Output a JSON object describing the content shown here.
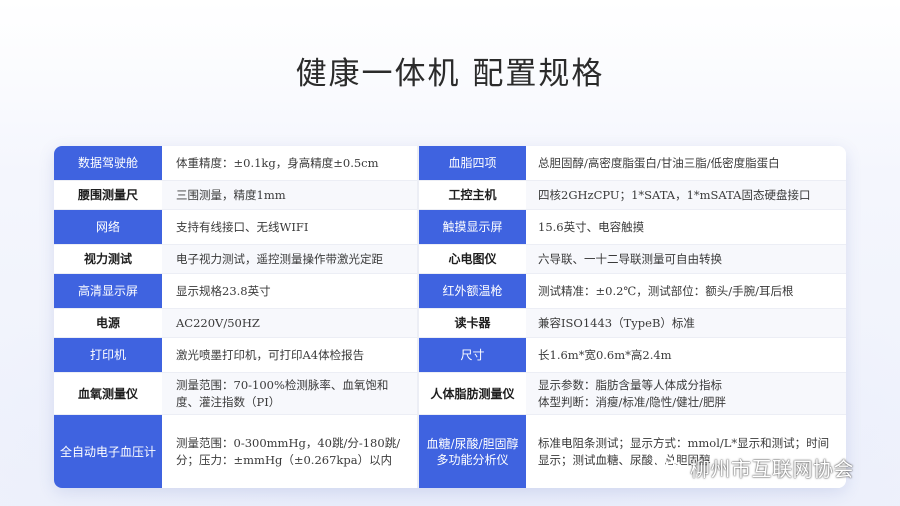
{
  "title": "健康一体机  配置规格",
  "rows": [
    {
      "style": "blue",
      "label1": "数据驾驶舱",
      "value1": "体重精度：±0.1kg，身高精度±0.5cm",
      "label2": "血脂四项",
      "value2": "总胆固醇/高密度脂蛋白/甘油三脂/低密度脂蛋白"
    },
    {
      "style": "white",
      "label1": "腰围测量尺",
      "value1": "三围测量，精度1mm",
      "label2": "工控主机",
      "value2": "四核2GHzCPU；1*SATA，1*mSATA固态硬盘接口"
    },
    {
      "style": "blue",
      "label1": "网络",
      "value1": "支持有线接口、无线WIFI",
      "label2": "触摸显示屏",
      "value2": "15.6英寸、电容触摸"
    },
    {
      "style": "white",
      "label1": "视力测试",
      "value1": "电子视力测试，遥控测量操作带激光定距",
      "label2": "心电图仪",
      "value2": "六导联、一十二导联测量可自由转换"
    },
    {
      "style": "blue",
      "label1": "高清显示屏",
      "value1": "显示规格23.8英寸",
      "label2": "红外额温枪",
      "value2": "测试精准：±0.2℃，测试部位：额头/手腕/耳后根"
    },
    {
      "style": "white",
      "label1": "电源",
      "value1": "AC220V/50HZ",
      "label2": "读卡器",
      "value2": "兼容ISO1443（TypeB）标准"
    },
    {
      "style": "blue",
      "label1": "打印机",
      "value1": "激光喷墨打印机，可打印A4体检报告",
      "label2": "尺寸",
      "value2": "长1.6m*宽0.6m*高2.4m"
    },
    {
      "style": "white",
      "label1": "血氧测量仪",
      "value1": "测量范围：70-100%检测脉率、血氧饱和度、灌注指数（PI）",
      "label2": "人体脂肪测量仪",
      "value2": "显示参数：脂肪含量等人体成分指标\n体型判断：消瘦/标准/隐性/健壮/肥胖"
    },
    {
      "style": "blue",
      "label1": "全自动电子血压计",
      "value1": "测量范围：0-300mmHg，40跳/分-180跳/分；压力：±mmHg（±0.267kpa）以内",
      "label2": "血糖/尿酸/胆固醇多功能分析仪",
      "value2": "标准电阻条测试；显示方式：mmol/L*显示和测试；时间显示；测试血糖、尿酸、总胆固醇"
    }
  ],
  "watermark": {
    "text": "柳州市互联网协会",
    "icon": "wechat-icon"
  },
  "colors": {
    "accent": "#3f63e0",
    "title": "#2b2b2b",
    "card": "#ffffff"
  }
}
